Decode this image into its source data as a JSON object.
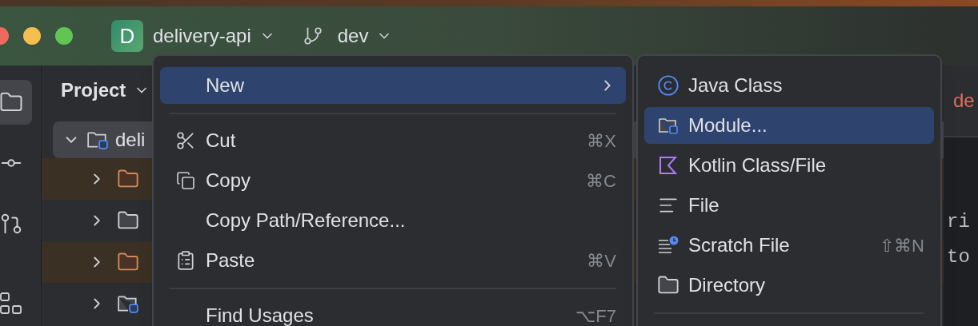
{
  "title_bar": {
    "project_badge": "D",
    "project": "delivery-api",
    "branch": "dev"
  },
  "tool_strip": [
    {
      "selected": true
    },
    {
      "selected": false
    },
    {
      "selected": false
    },
    {
      "selected": false
    }
  ],
  "project_panel": {
    "title": "Project",
    "tree": [
      {
        "label": "deli",
        "kind": "module",
        "expanded": true,
        "selected": true,
        "children": [
          {
            "kind": "excluded",
            "expanded": false
          },
          {
            "kind": "folder",
            "expanded": false
          },
          {
            "kind": "excluded",
            "expanded": false
          },
          {
            "kind": "module",
            "expanded": false
          }
        ]
      }
    ]
  },
  "editor": {
    "tab": "de",
    "code_lines": [
      "ri",
      "to"
    ]
  },
  "context_menu": {
    "items": [
      {
        "kind": "item",
        "label": "New",
        "selected": true,
        "submenu": true
      },
      {
        "kind": "separator"
      },
      {
        "kind": "item",
        "label": "Cut",
        "shortcut": "⌘X",
        "selected": false
      },
      {
        "kind": "item",
        "label": "Copy",
        "shortcut": "⌘C",
        "selected": false
      },
      {
        "kind": "item",
        "label": "Copy Path/Reference...",
        "selected": false
      },
      {
        "kind": "item",
        "label": "Paste",
        "shortcut": "⌘V",
        "selected": false
      },
      {
        "kind": "separator"
      },
      {
        "kind": "item",
        "label": "Find Usages",
        "shortcut": "⌥F7",
        "selected": false
      }
    ]
  },
  "submenu": {
    "items": [
      {
        "kind": "item",
        "label": "Java Class",
        "selected": false
      },
      {
        "kind": "item",
        "label": "Module...",
        "selected": true
      },
      {
        "kind": "item",
        "label": "Kotlin Class/File",
        "selected": false
      },
      {
        "kind": "item",
        "label": "File",
        "selected": false
      },
      {
        "kind": "item",
        "label": "Scratch File",
        "shortcut": "⇧⌘N",
        "selected": false
      },
      {
        "kind": "item",
        "label": "Directory",
        "selected": false
      },
      {
        "kind": "separator"
      }
    ]
  }
}
